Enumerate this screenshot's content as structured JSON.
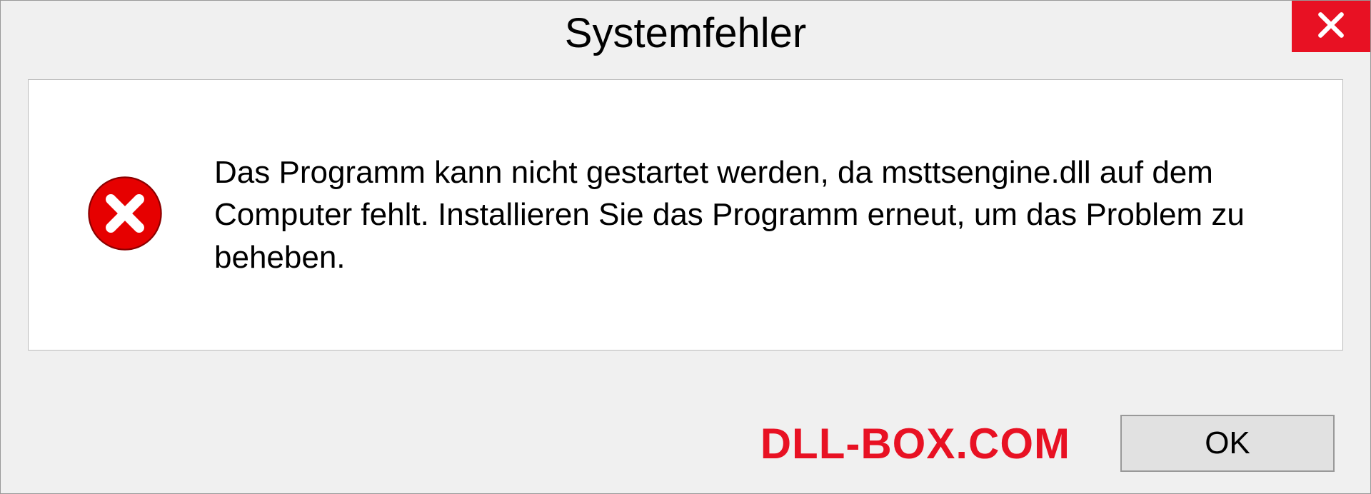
{
  "dialog": {
    "title": "Systemfehler",
    "message": "Das Programm kann nicht gestartet werden, da msttsengine.dll auf dem Computer fehlt. Installieren Sie das Programm erneut, um das Problem zu beheben.",
    "ok_label": "OK"
  },
  "watermark": "DLL-BOX.COM",
  "colors": {
    "close_bg": "#e81123",
    "error_icon": "#e60000",
    "watermark": "#e81123"
  }
}
